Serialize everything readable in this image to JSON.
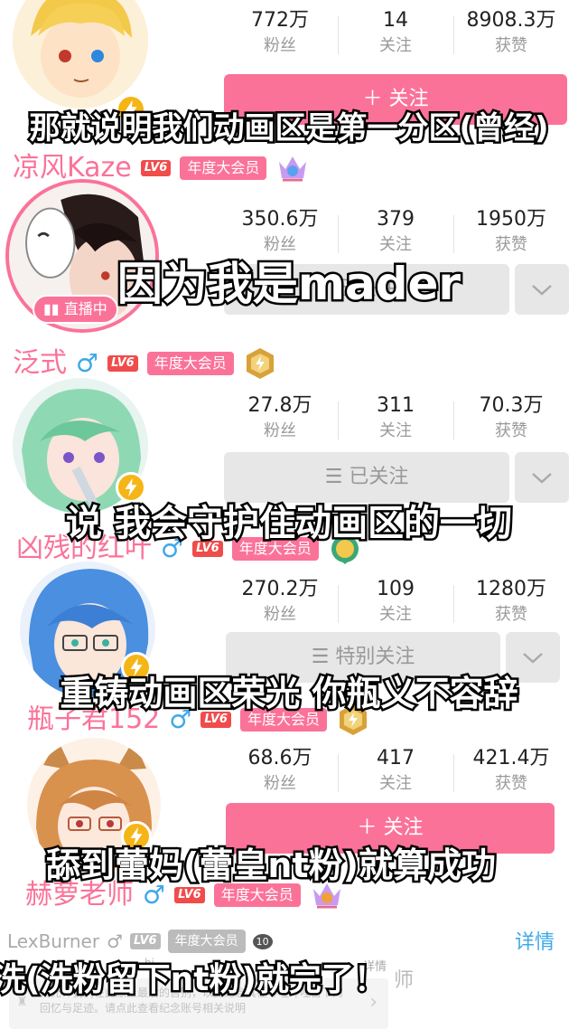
{
  "users": [
    {
      "fans": "772万",
      "follows": "14",
      "likes": "8908.3万",
      "fans_label": "粉丝",
      "follows_label": "关注",
      "likes_label": "获赞",
      "button": "＋ 关注"
    },
    {
      "name": "凉风Kaze",
      "level": "LV6",
      "vip": "年度大会员",
      "fans": "350.6万",
      "follows": "379",
      "likes": "1950万",
      "fans_label": "粉丝",
      "follows_label": "关注",
      "likes_label": "获赞",
      "button": "已关注",
      "live": "直播中"
    },
    {
      "name": "泛式",
      "gender": "♂",
      "level": "LV6",
      "vip": "年度大会员",
      "fans": "27.8万",
      "follows": "311",
      "likes": "70.3万",
      "fans_label": "粉丝",
      "follows_label": "关注",
      "likes_label": "获赞",
      "button": "☰ 已关注"
    },
    {
      "name": "凶残的红叶",
      "gender": "♂",
      "level": "LV6",
      "vip": "年度大会员",
      "fans": "270.2万",
      "follows": "109",
      "likes": "1280万",
      "fans_label": "粉丝",
      "follows_label": "关注",
      "likes_label": "获赞",
      "button": "☰ 特别关注"
    },
    {
      "name": "瓶子君152",
      "gender": "♂",
      "level": "LV6",
      "vip": "年度大会员",
      "fans": "68.6万",
      "follows": "417",
      "likes": "421.4万",
      "fans_label": "粉丝",
      "follows_label": "关注",
      "likes_label": "获赞",
      "button": "＋ 关注"
    },
    {
      "name": "赫萝老师",
      "gender": "♂",
      "level": "LV6",
      "vip": "年度大会员"
    }
  ],
  "lex": {
    "name": "LexBurner",
    "gender": "♂",
    "level": "LV6",
    "vip": "年度大会员",
    "medal": "10",
    "detail": "详情",
    "memorial": "请允许我们在此献上最后的告别，以此纪念其在哔哩哔哩留下的回忆与足迹。请点此查看纪念账号相关说明",
    "hint": "bi...",
    "detail2": "详情",
    "tail": "师"
  },
  "subtitles": [
    "那就说明我们动画区是第一分区(曾经)",
    "因为我是mader",
    "说 我会守护住动画区的一切",
    "重铸动画区荣光 你瓶义不容辞",
    "舔到蕾妈(蕾皇nt粉)就算成功",
    "洗(洗粉留下nt粉)就完了！"
  ],
  "colors": {
    "pink": "#fb7299",
    "blue": "#3ea9e8",
    "gray_btn": "#e7e7e7",
    "gold": "#f6b516"
  }
}
